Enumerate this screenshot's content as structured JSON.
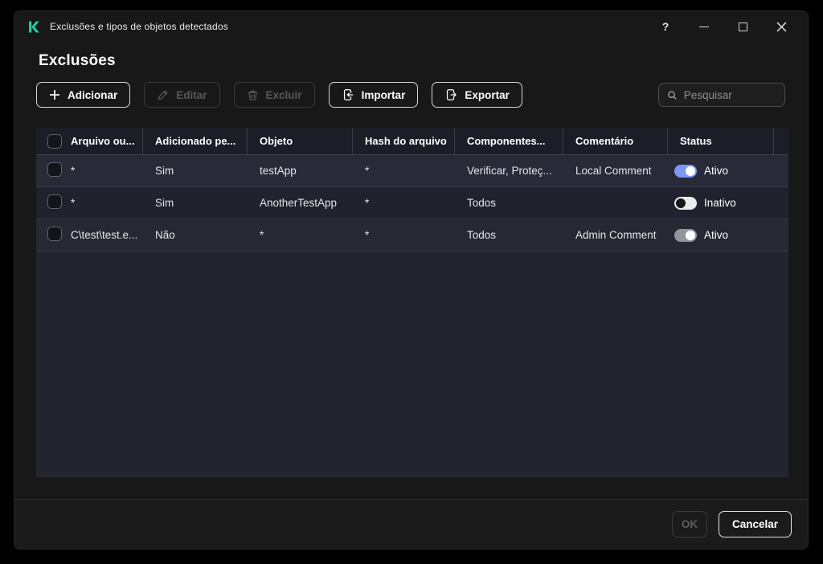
{
  "window": {
    "title": "Exclusões e tipos de objetos detectados",
    "help": "?"
  },
  "page": {
    "title": "Exclusões"
  },
  "toolbar": {
    "add": "Adicionar",
    "edit": "Editar",
    "delete": "Excluir",
    "import": "Importar",
    "export": "Exportar"
  },
  "search": {
    "placeholder": "Pesquisar"
  },
  "table": {
    "columns": [
      "Arquivo ou...",
      "Adicionado pe...",
      "Objeto",
      "Hash do arquivo",
      "Componentes...",
      "Comentário",
      "Status"
    ],
    "rows": [
      {
        "arquivo": "*",
        "adicionado": "Sim",
        "objeto": "testApp",
        "hash": "*",
        "componentes": "Verificar, Proteç...",
        "comentario": "Local Comment",
        "status": {
          "label": "Ativo",
          "state": "on-accent"
        }
      },
      {
        "arquivo": "*",
        "adicionado": "Sim",
        "objeto": "AnotherTestApp",
        "hash": "*",
        "componentes": "Todos",
        "comentario": "",
        "status": {
          "label": "Inativo",
          "state": "off"
        }
      },
      {
        "arquivo": "C\\test\\test.e...",
        "adicionado": "Não",
        "objeto": "*",
        "hash": "*",
        "componentes": "Todos",
        "comentario": "Admin Comment",
        "status": {
          "label": "Ativo",
          "state": "on-gray"
        }
      }
    ]
  },
  "footer": {
    "ok": "OK",
    "cancel": "Cancelar"
  },
  "colors": {
    "logo": "#23cfa5",
    "toggle_accent": "#7d97f4",
    "toggle_off_track": "#ebebeb",
    "toggle_gray": "#94949b",
    "table_header_bg": "#1b1d27"
  }
}
